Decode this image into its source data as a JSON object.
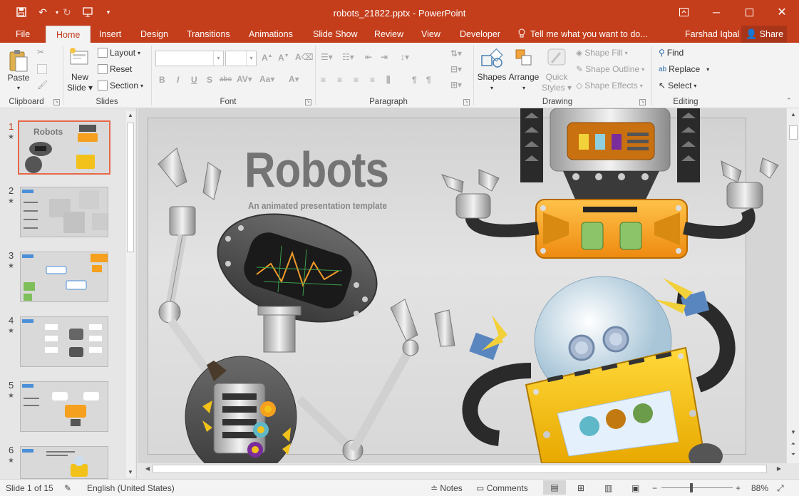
{
  "window": {
    "title": "robots_21822.pptx - PowerPoint"
  },
  "tabs": [
    "File",
    "Home",
    "Insert",
    "Design",
    "Transitions",
    "Animations",
    "Slide Show",
    "Review",
    "View",
    "Developer"
  ],
  "tell_me": "Tell me what you want to do...",
  "user_name": "Farshad Iqbal",
  "share_label": "Share",
  "ribbon": {
    "clipboard": {
      "paste": "Paste",
      "label": "Clipboard"
    },
    "slides": {
      "new_slide": "New",
      "new_slide2": "Slide",
      "layout": "Layout",
      "reset": "Reset",
      "section": "Section",
      "label": "Slides"
    },
    "font": {
      "label": "Font"
    },
    "paragraph": {
      "label": "Paragraph"
    },
    "drawing": {
      "shapes": "Shapes",
      "arrange": "Arrange",
      "quick_styles": "Quick",
      "quick_styles2": "Styles",
      "shape_fill": "Shape Fill",
      "shape_outline": "Shape Outline",
      "shape_effects": "Shape Effects",
      "label": "Drawing"
    },
    "editing": {
      "find": "Find",
      "replace": "Replace",
      "select": "Select",
      "label": "Editing"
    }
  },
  "slides": [
    {
      "num": "1",
      "star": "★"
    },
    {
      "num": "2",
      "star": "★"
    },
    {
      "num": "3",
      "star": "★"
    },
    {
      "num": "4",
      "star": "★"
    },
    {
      "num": "5",
      "star": "★"
    },
    {
      "num": "6",
      "star": "★"
    }
  ],
  "thumb_texts": {
    "t1": "Robots"
  },
  "slide": {
    "title": "Robots",
    "subtitle": "An animated presentation template"
  },
  "status": {
    "slide_of": "Slide 1 of 15",
    "language": "English (United States)",
    "notes": "Notes",
    "comments": "Comments",
    "zoom": "88%"
  },
  "colors": {
    "accent": "#c43e1c",
    "robot_orange": "#f5a01e",
    "robot_yellow": "#f2c21a"
  }
}
